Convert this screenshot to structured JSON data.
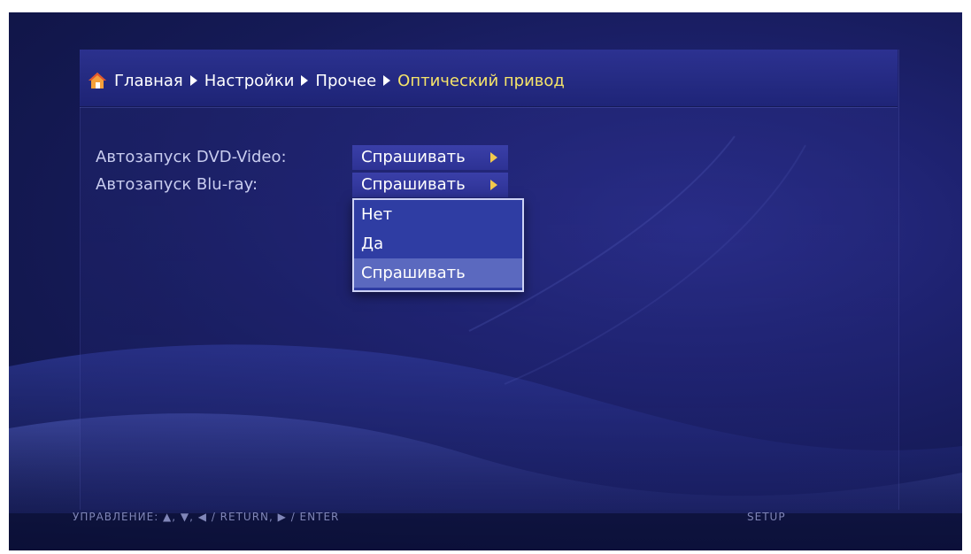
{
  "breadcrumb": {
    "items": [
      "Главная",
      "Настройки",
      "Прочее",
      "Оптический привод"
    ]
  },
  "settings": [
    {
      "label": "Автозапуск DVD-Video:",
      "value": "Спрашивать"
    },
    {
      "label": "Автозапуск Blu-ray:",
      "value": "Спрашивать"
    }
  ],
  "dropdown": {
    "options": [
      "Нет",
      "Да",
      "Спрашивать"
    ],
    "selected": "Спрашивать"
  },
  "footer": {
    "hint": "УПРАВЛЕНИЕ:  ▲, ▼, ◀ / RETURN,  ▶ / ENTER",
    "mode": "SETUP"
  },
  "colors": {
    "background": "#151a56",
    "header": "#2e3496",
    "current_crumb": "#f5e46a",
    "value_button": "#3a3fa8",
    "dropdown_bg": "#2f3da3",
    "dropdown_selected": "#5b69bf",
    "arrow_accent": "#f2c94c"
  },
  "icons": {
    "home": "home-icon",
    "breadcrumb_separator": "chevron-right-icon",
    "value_arrow": "chevron-right-icon"
  }
}
